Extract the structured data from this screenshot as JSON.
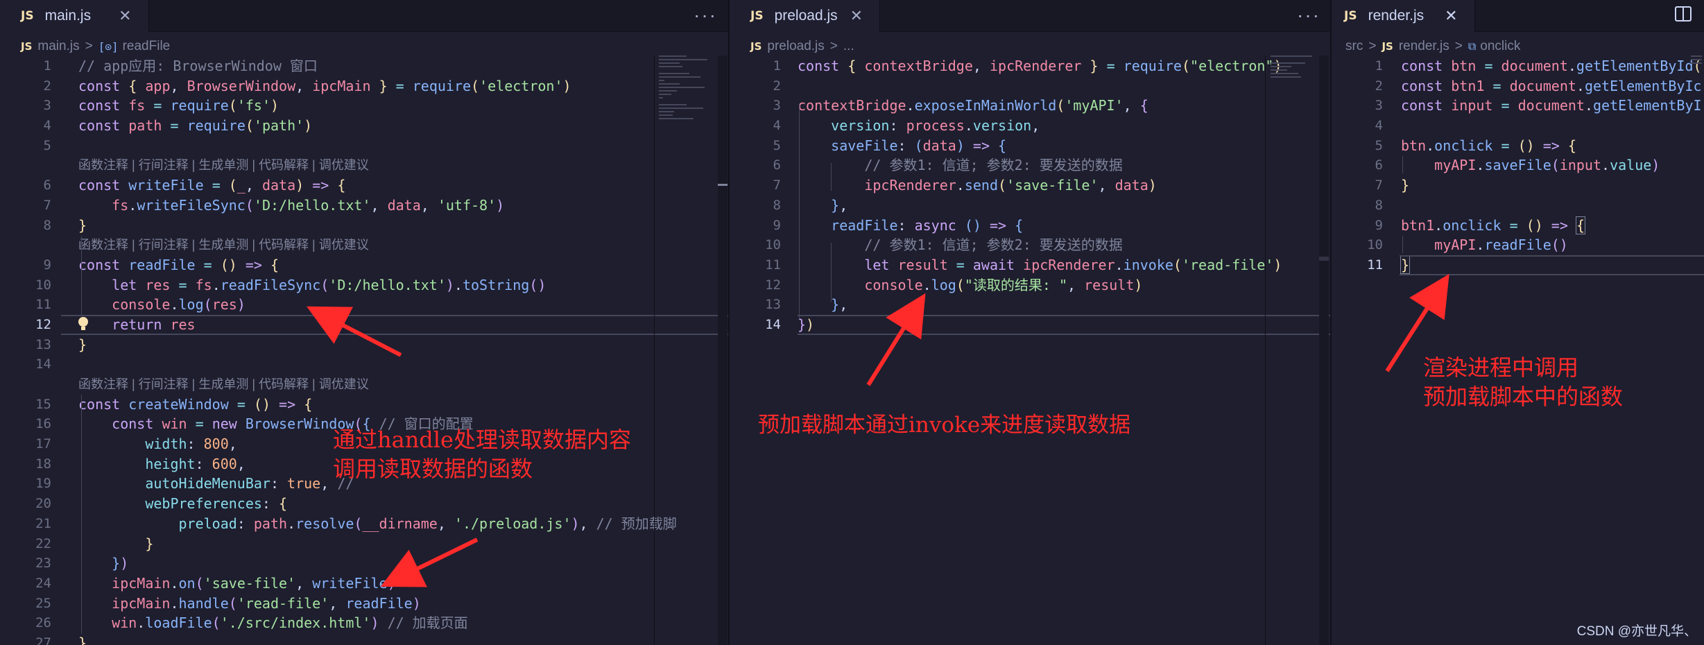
{
  "panes": {
    "main": {
      "tab": {
        "badge": "JS",
        "name": "main.js",
        "close": "✕"
      },
      "more": "···",
      "breadcrumb": {
        "file": "main.js",
        "separator": ">",
        "symbol": "readFile"
      },
      "lens_text": "函数注释 | 行间注释 | 生成单测 | 代码解释 | 调优建议",
      "lines": [
        {
          "n": "1",
          "t": "// app应用: BrowserWindow 窗口"
        },
        {
          "n": "2",
          "t": "const { app, BrowserWindow, ipcMain } = require('electron')"
        },
        {
          "n": "3",
          "t": "const fs = require('fs')"
        },
        {
          "n": "4",
          "t": "const path = require('path')"
        },
        {
          "n": "5",
          "t": ""
        },
        {
          "n": "6",
          "t": "const writeFile = (_, data) => {"
        },
        {
          "n": "7",
          "t": "    fs.writeFileSync('D:/hello.txt', data, 'utf-8')"
        },
        {
          "n": "8",
          "t": "}"
        },
        {
          "n": "9",
          "t": "const readFile = () => {"
        },
        {
          "n": "10",
          "t": "    let res = fs.readFileSync('D:/hello.txt').toString()"
        },
        {
          "n": "11",
          "t": "    console.log(res)"
        },
        {
          "n": "12",
          "t": "    return res"
        },
        {
          "n": "13",
          "t": "}"
        },
        {
          "n": "14",
          "t": ""
        },
        {
          "n": "15",
          "t": "const createWindow = () => {"
        },
        {
          "n": "16",
          "t": "    const win = new BrowserWindow({ // 窗口的配置"
        },
        {
          "n": "17",
          "t": "        width: 800,"
        },
        {
          "n": "18",
          "t": "        height: 600,"
        },
        {
          "n": "19",
          "t": "        autoHideMenuBar: true, //"
        },
        {
          "n": "20",
          "t": "        webPreferences: {"
        },
        {
          "n": "21",
          "t": "            preload: path.resolve(__dirname, './preload.js'), // 预加载脚"
        },
        {
          "n": "22",
          "t": "        }"
        },
        {
          "n": "23",
          "t": "    })"
        },
        {
          "n": "24",
          "t": "    ipcMain.on('save-file', writeFile)"
        },
        {
          "n": "25",
          "t": "    ipcMain.handle('read-file', readFile)"
        },
        {
          "n": "26",
          "t": "    win.loadFile('./src/index.html') // 加载页面"
        },
        {
          "n": "27",
          "t": "}"
        }
      ]
    },
    "preload": {
      "tab": {
        "badge": "JS",
        "name": "preload.js",
        "close": "✕"
      },
      "more": "···",
      "breadcrumb": {
        "file": "preload.js",
        "separator": ">",
        "symbol": "..."
      },
      "lines": [
        {
          "n": "1",
          "t": "const { contextBridge, ipcRenderer } = require(\"electron\")"
        },
        {
          "n": "2",
          "t": ""
        },
        {
          "n": "3",
          "t": "contextBridge.exposeInMainWorld('myAPI', {"
        },
        {
          "n": "4",
          "t": "    version: process.version,"
        },
        {
          "n": "5",
          "t": "    saveFile: (data) => {"
        },
        {
          "n": "6",
          "t": "        // 参数1: 信道; 参数2: 要发送的数据"
        },
        {
          "n": "7",
          "t": "        ipcRenderer.send('save-file', data)"
        },
        {
          "n": "8",
          "t": "    },"
        },
        {
          "n": "9",
          "t": "    readFile: async () => {"
        },
        {
          "n": "10",
          "t": "        // 参数1: 信道; 参数2: 要发送的数据"
        },
        {
          "n": "11",
          "t": "        let result = await ipcRenderer.invoke('read-file')"
        },
        {
          "n": "12",
          "t": "        console.log(\"读取的结果: \", result)"
        },
        {
          "n": "13",
          "t": "    },"
        },
        {
          "n": "14",
          "t": "})"
        }
      ]
    },
    "render": {
      "tab": {
        "badge": "JS",
        "name": "render.js",
        "close": "✕"
      },
      "breadcrumb": {
        "folder": "src",
        "file": "render.js",
        "separator": ">",
        "symbol": "onclick"
      },
      "lines": [
        {
          "n": "1",
          "t": "const btn = document.getElementById("
        },
        {
          "n": "2",
          "t": "const btn1 = document.getElementByIc"
        },
        {
          "n": "3",
          "t": "const input = document.getElementByI"
        },
        {
          "n": "4",
          "t": ""
        },
        {
          "n": "5",
          "t": "btn.onclick = () => {"
        },
        {
          "n": "6",
          "t": "    myAPI.saveFile(input.value)"
        },
        {
          "n": "7",
          "t": "}"
        },
        {
          "n": "8",
          "t": ""
        },
        {
          "n": "9",
          "t": "btn1.onclick = () => {"
        },
        {
          "n": "10",
          "t": "    myAPI.readFile()"
        },
        {
          "n": "11",
          "t": "}"
        }
      ]
    }
  },
  "annotations": {
    "main_line1": "通过handle处理读取数据内容",
    "main_line2": "调用读取数据的函数",
    "preload": "预加载脚本通过invoke来进度读取数据",
    "render_line1": "渲染进程中调用",
    "render_line2": "预加载脚本中的函数"
  },
  "watermark": "CSDN @亦世凡华、",
  "colors": {
    "annotation": "#ff2a2a",
    "keyword": "#cba6f7",
    "function": "#89b4fa",
    "string": "#a6e3a1",
    "background": "#1e1e2e"
  }
}
